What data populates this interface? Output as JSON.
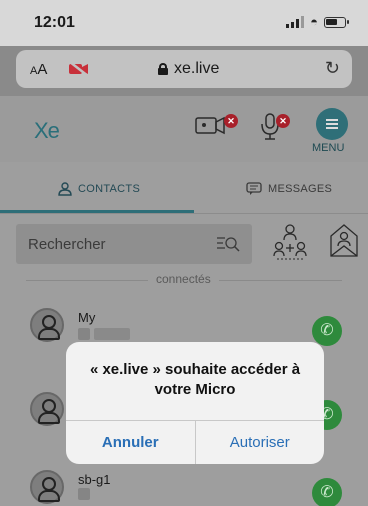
{
  "status_bar": {
    "time": "12:01"
  },
  "browser": {
    "text_size_label": "AA",
    "url": "xe.live"
  },
  "app": {
    "logo": "Xe",
    "menu_label": "MENU",
    "tabs": [
      {
        "label": "CONTACTS",
        "active": true
      },
      {
        "label": "MESSAGES",
        "active": false
      }
    ],
    "search_placeholder": "Rechercher",
    "section_label": "connectés",
    "contacts": [
      {
        "name": "My"
      },
      {
        "name": ""
      },
      {
        "name": "sb-g1"
      }
    ]
  },
  "dialog": {
    "message": "« xe.live » souhaite accéder à votre Micro",
    "cancel_label": "Annuler",
    "allow_label": "Autoriser"
  },
  "colors": {
    "accent": "#2f6f78",
    "call_green": "#2e8a3c",
    "badge_red": "#a8202a",
    "link_blue": "#2a6fb6"
  }
}
